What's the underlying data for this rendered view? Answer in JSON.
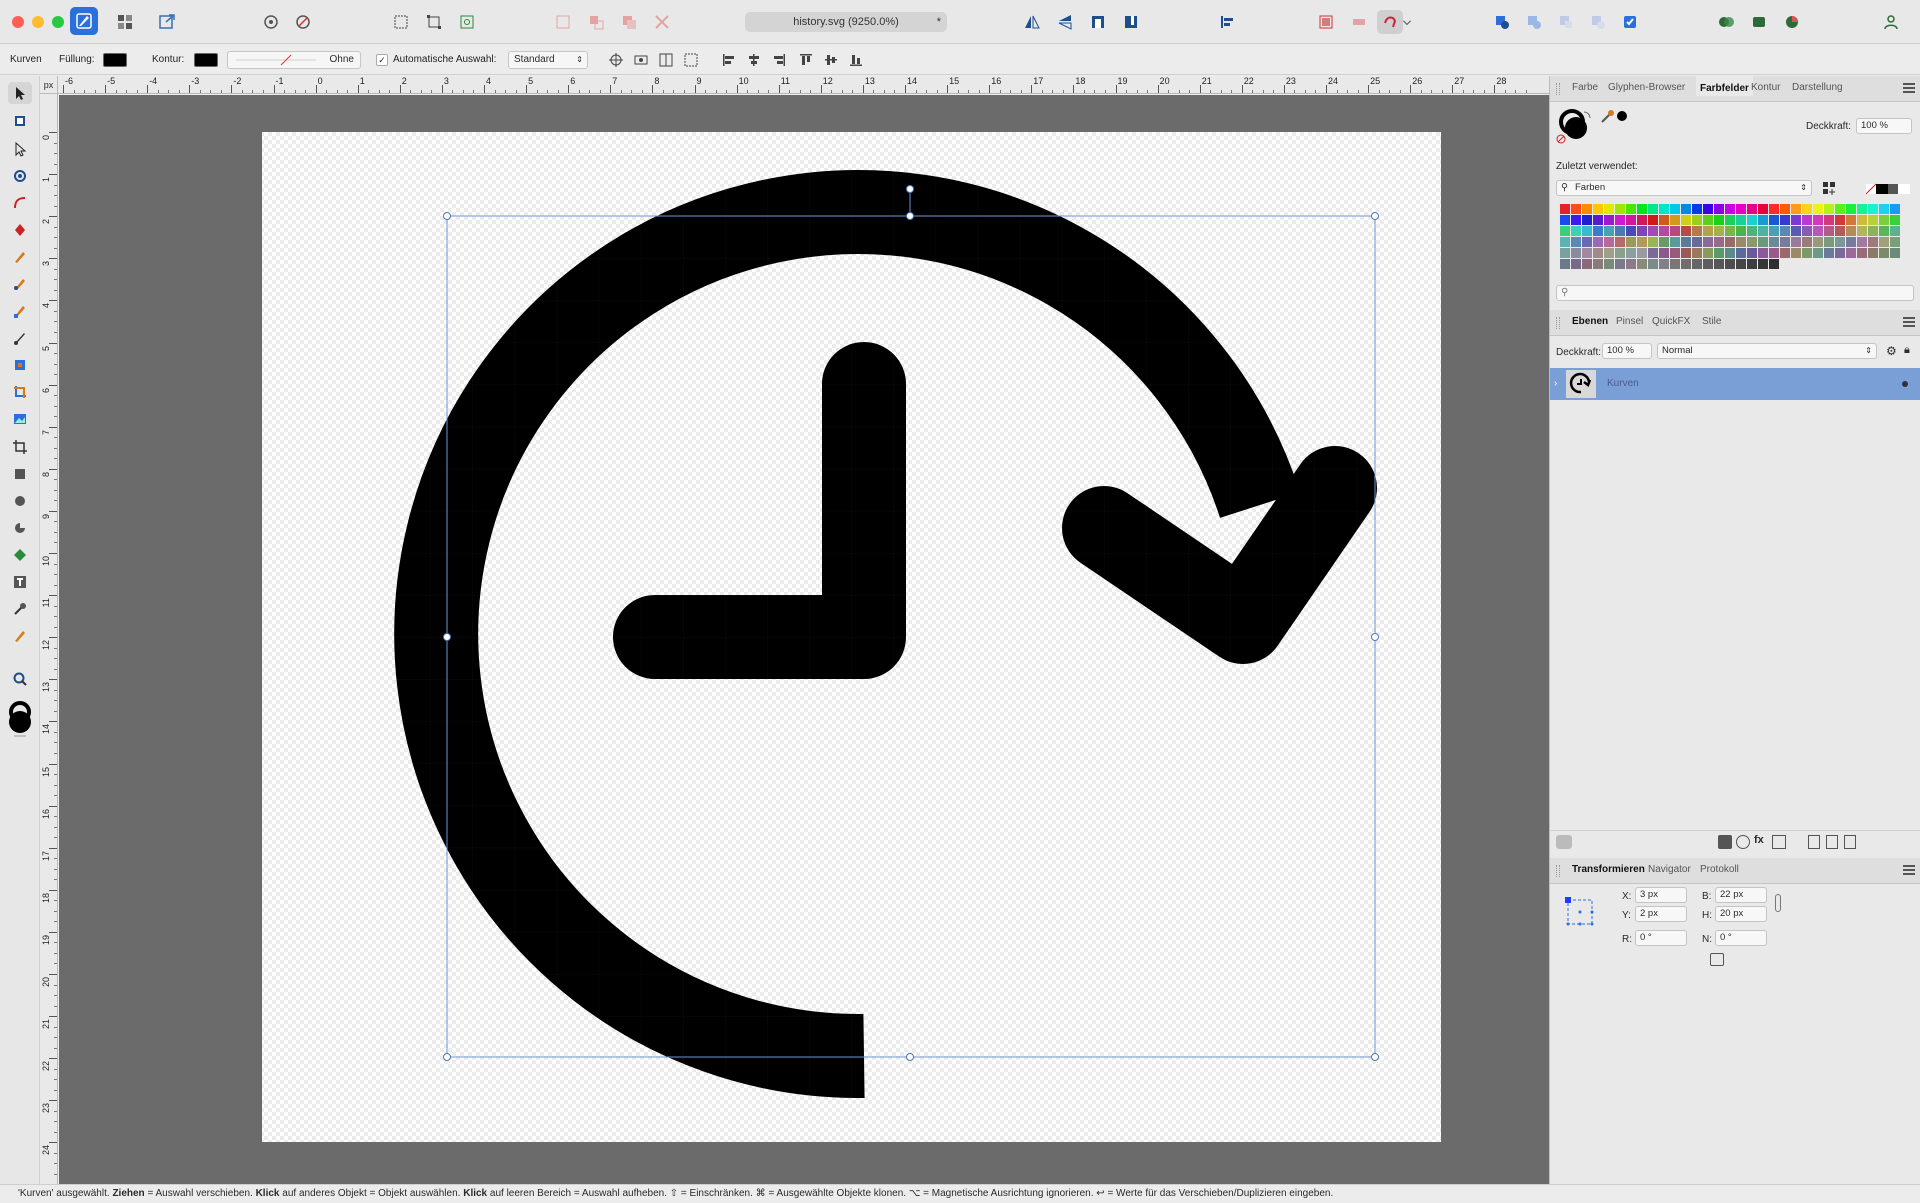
{
  "titlebar": {
    "document_title": "history.svg (9250.0%)",
    "modified_marker": "*"
  },
  "context": {
    "tool_name": "Kurven",
    "fill_label": "Füllung:",
    "stroke_label": "Kontur:",
    "stroke_style_value": "Ohne",
    "auto_select_label": "Automatische Auswahl:",
    "auto_select_checked": true,
    "auto_select_mode": "Standard"
  },
  "ruler": {
    "unit": "px",
    "top_ticks": [
      "-6",
      "-5",
      "-4",
      "-3",
      "-2",
      "-1",
      "0",
      "1",
      "2",
      "3",
      "4",
      "5",
      "6",
      "7",
      "8",
      "9",
      "10",
      "11",
      "12",
      "13",
      "14",
      "15",
      "16",
      "17",
      "18",
      "19",
      "20",
      "21",
      "22",
      "23",
      "24",
      "25",
      "26",
      "27",
      "28"
    ],
    "left_ticks": [
      "0",
      "1",
      "2",
      "3",
      "4",
      "5",
      "6",
      "7",
      "8",
      "9",
      "10",
      "11",
      "12",
      "13",
      "14",
      "15",
      "16",
      "17",
      "18",
      "19",
      "20",
      "21",
      "22",
      "23",
      "24"
    ]
  },
  "panel_top": {
    "tabs": [
      "Farbe",
      "Glyphen-Browser",
      "Farbfelder",
      "Kontur",
      "Darstellung"
    ],
    "active_tab": "Farbfelder",
    "opacity_label": "Deckkraft:",
    "opacity_value": "100 %",
    "recent_label": "Zuletzt verwendet:",
    "palette_name": "Farben",
    "search_placeholder": ""
  },
  "panel_layers": {
    "tabs": [
      "Ebenen",
      "Pinsel",
      "QuickFX",
      "Stile"
    ],
    "active_tab": "Ebenen",
    "opacity_label": "Deckkraft:",
    "opacity_value": "100 %",
    "blend_mode": "Normal",
    "layers": [
      {
        "name": "Kurven",
        "selected": true
      }
    ]
  },
  "panel_transform": {
    "tabs": [
      "Transformieren",
      "Navigator",
      "Protokoll"
    ],
    "active_tab": "Transformieren",
    "x_label": "X:",
    "x_value": "3 px",
    "y_label": "Y:",
    "y_value": "2 px",
    "w_label": "B:",
    "w_value": "22 px",
    "h_label": "H:",
    "h_value": "20 px",
    "r_label": "R:",
    "r_value": "0 °",
    "s_label": "N:",
    "s_value": "0 °"
  },
  "status": {
    "p1": "'Kurven' ausgewählt. ",
    "b1": "Ziehen",
    "p2": " = Auswahl verschieben. ",
    "b2": "Klick",
    "p3": " auf anderes Objekt = Objekt auswählen. ",
    "b3": "Klick",
    "p4": " auf leeren Bereich = Auswahl aufheben. ⇧ = Einschränken. ⌘ = Ausgewählte Objekte klonen. ⌥ = Magnetische Ausrichtung ignorieren. ↩ = Werte für das Verschieben/Duplizieren eingeben."
  },
  "colors": {
    "accent": "#3b82f6",
    "selection": "#7a9fd6",
    "canvas_bg": "#6b6b6b",
    "shape_fill": "#000000"
  },
  "icons": [
    "designer-persona-icon",
    "pixel-persona-icon",
    "export-persona-icon",
    "snapping-icon",
    "assistant-icon",
    "flip-horizontal-icon",
    "flip-vertical-icon",
    "boolean-add-icon",
    "user-icon"
  ]
}
